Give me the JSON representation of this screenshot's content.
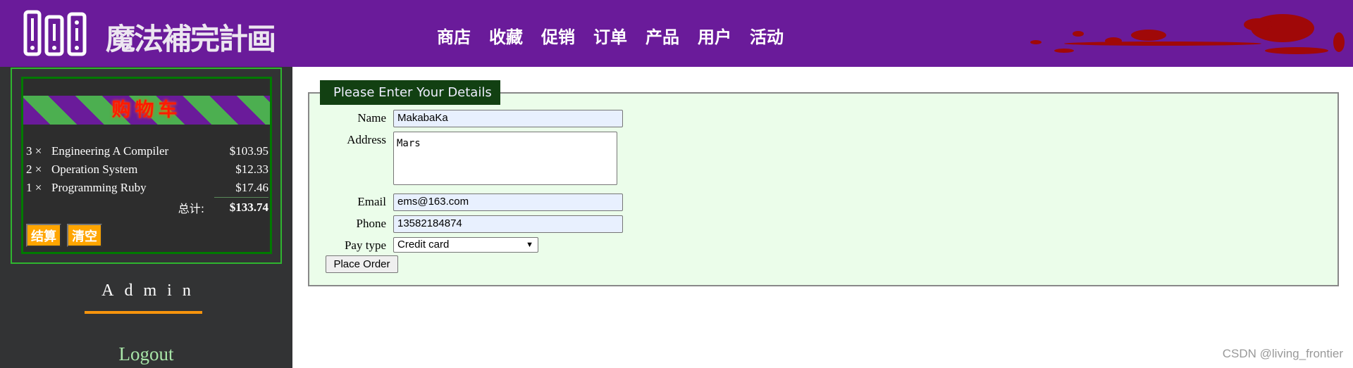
{
  "header": {
    "brand": "魔法補完計画",
    "nav": [
      "商店",
      "收藏",
      "促销",
      "订单",
      "产品",
      "用户",
      "活动"
    ]
  },
  "cart": {
    "title": "购物车",
    "items": [
      {
        "qty": "3 ×",
        "title": "Engineering A Compiler",
        "price": "$103.95"
      },
      {
        "qty": "2 ×",
        "title": "Operation System",
        "price": "$12.33"
      },
      {
        "qty": "1 ×",
        "title": "Programming Ruby",
        "price": "$17.46"
      }
    ],
    "total_label": "总计:",
    "total": "$133.74",
    "checkout": "结算",
    "empty": "清空"
  },
  "sidebar": {
    "admin": "Admin",
    "logout": "Logout"
  },
  "form": {
    "legend": "Please Enter Your Details",
    "name_label": "Name",
    "name": "MakabaKa",
    "address_label": "Address",
    "address": "Mars",
    "email_label": "Email",
    "email": "ems@163.com",
    "phone_label": "Phone",
    "phone": "13582184874",
    "pay_label": "Pay type",
    "pay": "Credit card",
    "submit": "Place Order"
  },
  "watermark": "CSDN @living_frontier",
  "colors": {
    "header": "#6a1b9a",
    "sidebar": "#323334",
    "accent": "#ffa500",
    "form_bg": "#ebfdea",
    "legend_bg": "#124012"
  }
}
